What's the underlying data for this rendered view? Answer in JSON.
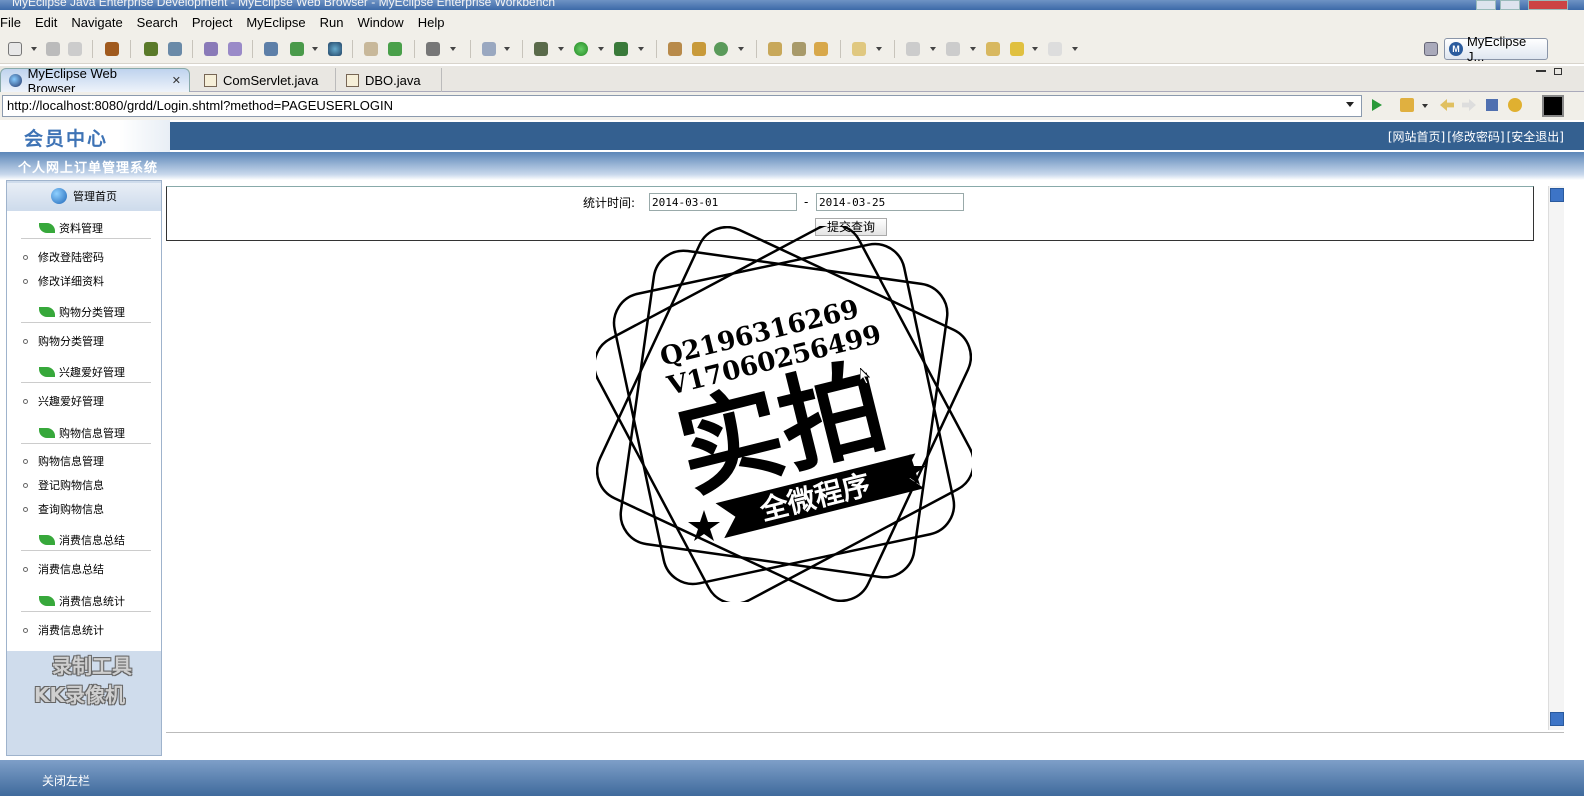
{
  "window": {
    "title": "MyEclipse Java Enterprise Development - MyEclipse Web Browser - MyEclipse Enterprise Workbench"
  },
  "menu": [
    "File",
    "Edit",
    "Navigate",
    "Search",
    "Project",
    "MyEclipse",
    "Run",
    "Window",
    "Help"
  ],
  "perspective": {
    "label": "MyEclipse J..."
  },
  "tabs": [
    {
      "label": "MyEclipse Web Browser",
      "icon": "globe-icon",
      "active": true
    },
    {
      "label": "ComServlet.java",
      "icon": "java-file-icon",
      "active": false
    },
    {
      "label": "DBO.java",
      "icon": "java-file-icon",
      "active": false
    }
  ],
  "address": {
    "url": "http://localhost:8080/grdd/Login.shtml?method=PAGEUSERLOGIN"
  },
  "page": {
    "logo_text": "会员中心",
    "top_links": [
      "[网站首页]",
      "[修改密码]",
      "[安全退出]"
    ],
    "system_title": "个人网上订单管理系统",
    "home_label": "管理首页",
    "sidebar": [
      {
        "type": "group",
        "label": "资料管理"
      },
      {
        "type": "item",
        "label": "修改登陆密码"
      },
      {
        "type": "item",
        "label": "修改详细资料"
      },
      {
        "type": "group",
        "label": "购物分类管理"
      },
      {
        "type": "item",
        "label": "购物分类管理"
      },
      {
        "type": "group",
        "label": "兴趣爱好管理"
      },
      {
        "type": "item",
        "label": "兴趣爱好管理"
      },
      {
        "type": "group",
        "label": "购物信息管理"
      },
      {
        "type": "item",
        "label": "购物信息管理"
      },
      {
        "type": "item",
        "label": "登记购物信息"
      },
      {
        "type": "item",
        "label": "查询购物信息"
      },
      {
        "type": "group",
        "label": "消费信息总结"
      },
      {
        "type": "item",
        "label": "消费信息总结"
      },
      {
        "type": "group",
        "label": "消费信息统计"
      },
      {
        "type": "item",
        "label": "消费信息统计"
      }
    ],
    "query": {
      "label": "统计时间:",
      "start": "2014-03-01",
      "end": "2014-03-25",
      "separator": "-",
      "submit": "提交查询"
    },
    "footer_label": "关闭左栏"
  },
  "overlay": {
    "stamp_line1": "Q2196316269",
    "stamp_line2": "V17060256499",
    "stamp_big": "实拍",
    "stamp_ribbon": "全微程序",
    "recorder_line1": "录制工具",
    "recorder_line2": "KK录像机"
  }
}
